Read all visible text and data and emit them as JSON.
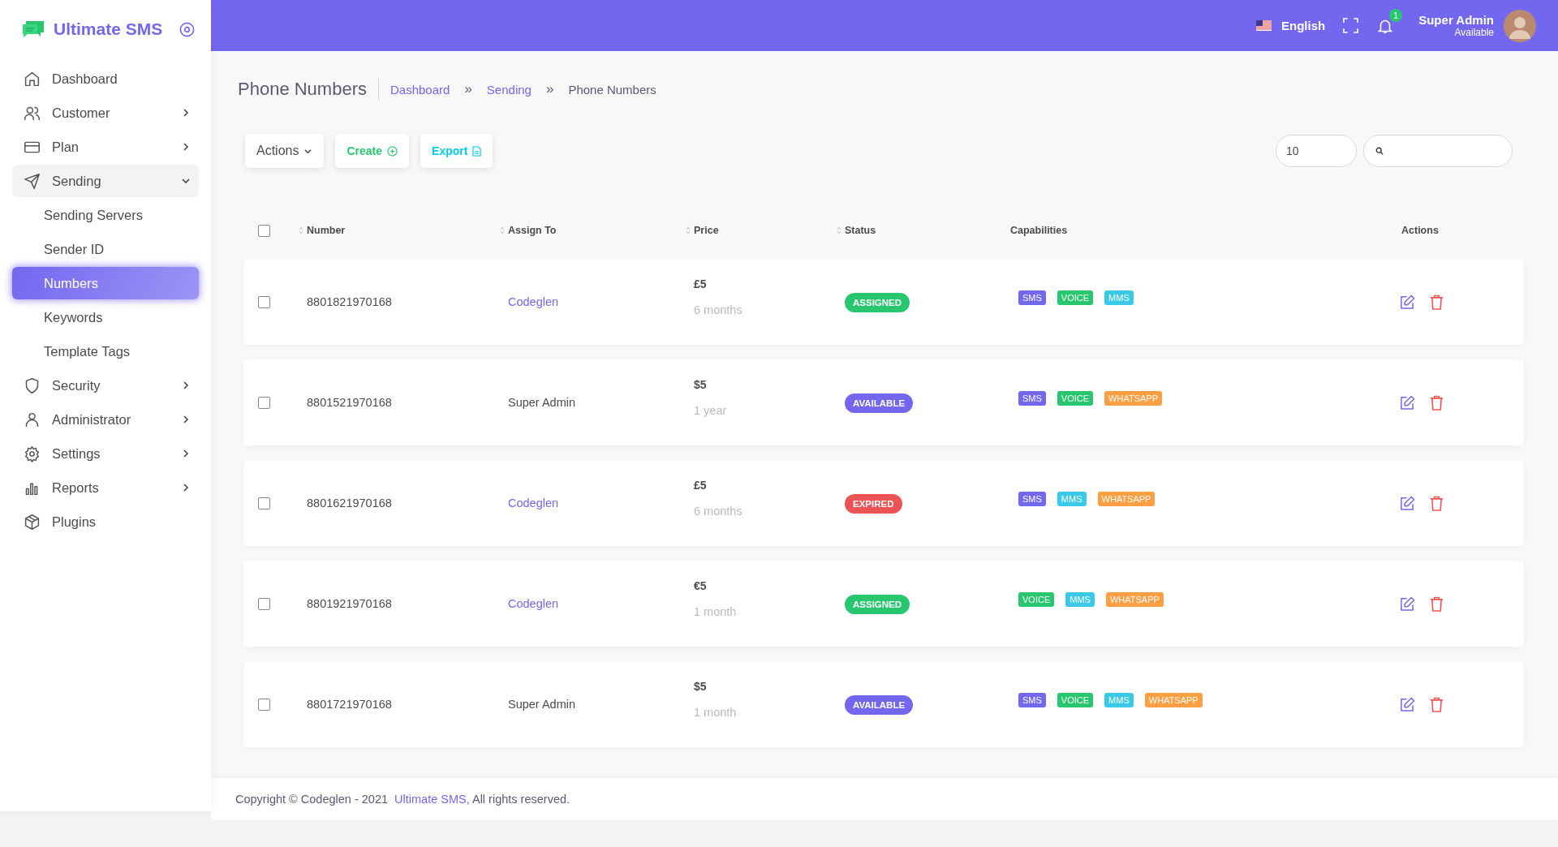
{
  "brand": {
    "name": "Ultimate SMS"
  },
  "sidebar": {
    "items": [
      {
        "label": "Dashboard",
        "expandable": false,
        "expanded": false,
        "selected": false
      },
      {
        "label": "Customer",
        "expandable": true,
        "expanded": false,
        "selected": false
      },
      {
        "label": "Plan",
        "expandable": true,
        "expanded": false,
        "selected": false
      },
      {
        "label": "Sending",
        "expandable": true,
        "expanded": true,
        "selected": false,
        "children": [
          {
            "label": "Sending Servers",
            "selected": false
          },
          {
            "label": "Sender ID",
            "selected": false
          },
          {
            "label": "Numbers",
            "selected": true
          },
          {
            "label": "Keywords",
            "selected": false
          },
          {
            "label": "Template Tags",
            "selected": false
          }
        ]
      },
      {
        "label": "Security",
        "expandable": true,
        "expanded": false,
        "selected": false
      },
      {
        "label": "Administrator",
        "expandable": true,
        "expanded": false,
        "selected": false
      },
      {
        "label": "Settings",
        "expandable": true,
        "expanded": false,
        "selected": false
      },
      {
        "label": "Reports",
        "expandable": true,
        "expanded": false,
        "selected": false
      },
      {
        "label": "Plugins",
        "expandable": false,
        "expanded": false,
        "selected": false
      }
    ]
  },
  "header": {
    "language": "English",
    "notifications": "1",
    "user_name": "Super Admin",
    "user_status": "Available"
  },
  "page": {
    "title": "Phone Numbers",
    "breadcrumb": [
      {
        "label": "Dashboard",
        "link": true
      },
      {
        "label": "Sending",
        "link": true
      },
      {
        "label": "Phone Numbers",
        "link": false
      }
    ],
    "separator": "»"
  },
  "toolbar": {
    "actions": "Actions",
    "create": "Create",
    "export": "Export",
    "page_size": "10"
  },
  "table": {
    "select_all": {
      "checked": false
    },
    "columns": [
      {
        "label": "Number",
        "sortable": true
      },
      {
        "label": "Assign To",
        "sortable": true
      },
      {
        "label": "Price",
        "sortable": true
      },
      {
        "label": "Status",
        "sortable": true
      },
      {
        "label": "Capabilities",
        "sortable": false
      },
      {
        "label": "Actions",
        "sortable": false
      }
    ],
    "rows": [
      {
        "checked": false,
        "number": "8801821970168",
        "assign_to": "Codeglen",
        "assign_link": true,
        "price": "£5",
        "period": "6 months",
        "status": "ASSIGNED",
        "kind": "assigned",
        "capabilities": [
          {
            "label": "SMS",
            "kind": "sms"
          },
          {
            "label": "VOICE",
            "kind": "voice"
          },
          {
            "label": "MMS",
            "kind": "mms"
          }
        ]
      },
      {
        "checked": false,
        "number": "8801521970168",
        "assign_to": "Super Admin",
        "assign_link": false,
        "price": "$5",
        "period": "1 year",
        "status": "AVAILABLE",
        "kind": "available",
        "capabilities": [
          {
            "label": "SMS",
            "kind": "sms"
          },
          {
            "label": "VOICE",
            "kind": "voice"
          },
          {
            "label": "WHATSAPP",
            "kind": "whatsapp"
          }
        ]
      },
      {
        "checked": false,
        "number": "8801621970168",
        "assign_to": "Codeglen",
        "assign_link": true,
        "price": "£5",
        "period": "6 months",
        "status": "EXPIRED",
        "kind": "expired",
        "capabilities": [
          {
            "label": "SMS",
            "kind": "sms"
          },
          {
            "label": "MMS",
            "kind": "mms"
          },
          {
            "label": "WHATSAPP",
            "kind": "whatsapp"
          }
        ]
      },
      {
        "checked": false,
        "number": "8801921970168",
        "assign_to": "Codeglen",
        "assign_link": true,
        "price": "€5",
        "period": "1 month",
        "status": "ASSIGNED",
        "kind": "assigned",
        "capabilities": [
          {
            "label": "VOICE",
            "kind": "voice"
          },
          {
            "label": "MMS",
            "kind": "mms"
          },
          {
            "label": "WHATSAPP",
            "kind": "whatsapp"
          }
        ]
      },
      {
        "checked": false,
        "number": "8801721970168",
        "assign_to": "Super Admin",
        "assign_link": false,
        "price": "$5",
        "period": "1 month",
        "status": "AVAILABLE",
        "kind": "available",
        "capabilities": [
          {
            "label": "SMS",
            "kind": "sms"
          },
          {
            "label": "VOICE",
            "kind": "voice"
          },
          {
            "label": "MMS",
            "kind": "mms"
          },
          {
            "label": "WHATSAPP",
            "kind": "whatsapp"
          }
        ]
      }
    ]
  },
  "footer": {
    "text_before": "Copyright © Codeglen - 2021",
    "link": "Ultimate SMS,",
    "text_after": "All rights reserved."
  }
}
